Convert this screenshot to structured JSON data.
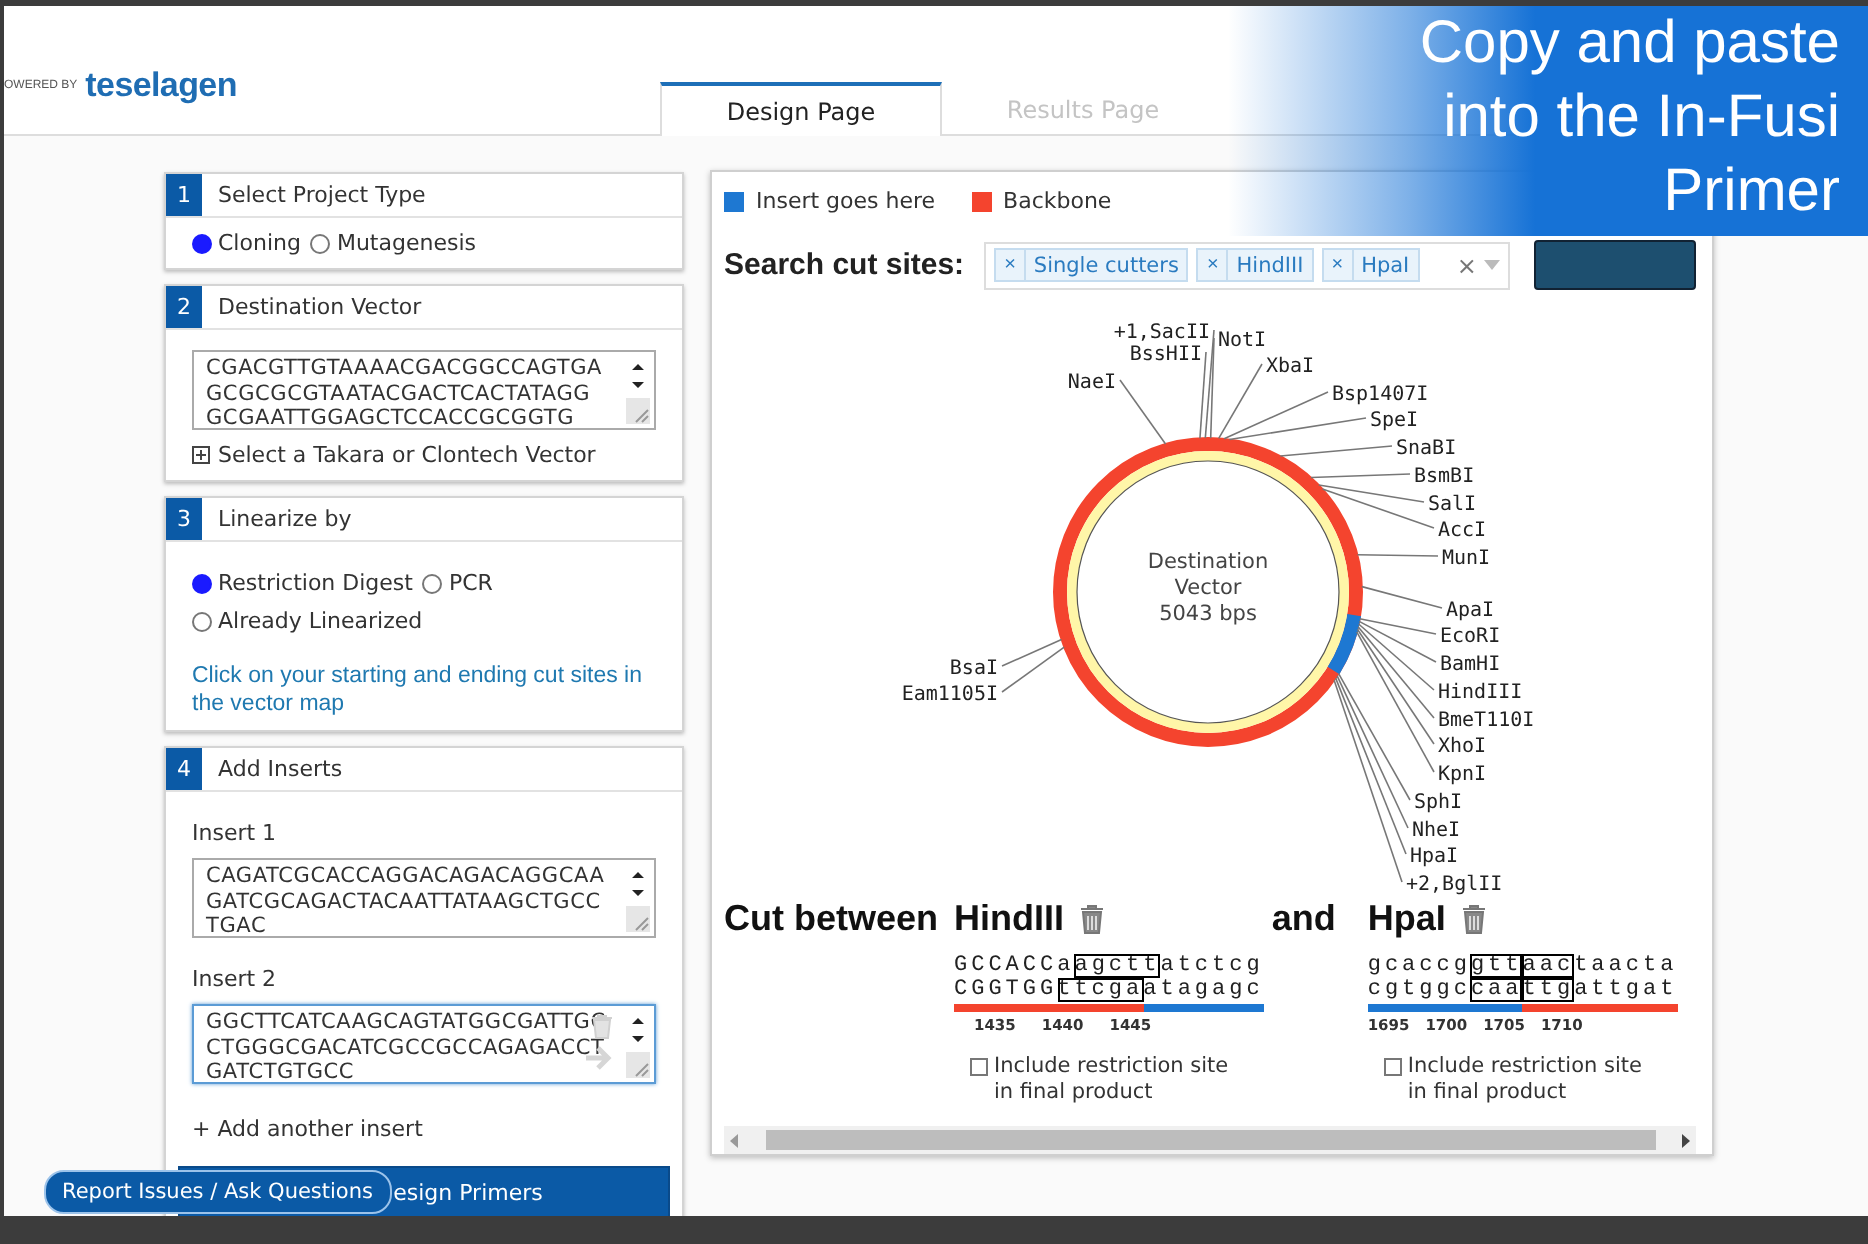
{
  "header": {
    "powered_by": "OWERED BY",
    "logo": "teselagen"
  },
  "tabs": [
    {
      "label": "Design Page",
      "selected": true
    },
    {
      "label": "Results Page",
      "selected": false
    }
  ],
  "steps": [
    {
      "number": "1",
      "title": "Select Project Type",
      "radio_rows": [
        [
          {
            "label": "Cloning",
            "selected": true
          },
          {
            "label": "Mutagenesis",
            "selected": false
          }
        ]
      ]
    },
    {
      "number": "2",
      "title": "Destination Vector",
      "sequence_lines": [
        "CGACGTTGTAAAACGACGGCCAGTGA",
        "GCGCGCGTAATACGACTCACTATAGG",
        "GCGAATTGGAGCTCCACCGCGGTG"
      ],
      "vector_link": "Select a Takara or Clontech Vector"
    },
    {
      "number": "3",
      "title": "Linearize by",
      "radio_rows": [
        [
          {
            "label": "Restriction Digest",
            "selected": true
          },
          {
            "label": "PCR",
            "selected": false
          }
        ],
        [
          {
            "label": "Already Linearized",
            "selected": false
          }
        ]
      ],
      "note": "Click on your starting and ending cut sites in the vector map"
    },
    {
      "number": "4",
      "title": "Add Inserts",
      "inserts": [
        {
          "label": "Insert 1",
          "focused": false,
          "lines": [
            "CAGATCGCACCAGGACAGACAGGCAA",
            "GATCGCAGACTACAATTATAAGCTGCC",
            "TGAC"
          ]
        },
        {
          "label": "Insert 2",
          "focused": true,
          "lines": [
            "GGCTTCATCAAGCAGTATGGCGATTGC",
            "CTGGGCGACATCGCCGCCAGAGACCT",
            "GATCTGTGCC"
          ]
        }
      ],
      "add_insert": "+ Add another insert",
      "primary_button": "esign Primers"
    }
  ],
  "map": {
    "legend": [
      {
        "label": "Insert goes here",
        "kind": "insert"
      },
      {
        "label": "Backbone",
        "kind": "backbone"
      }
    ],
    "search_label": "Search cut sites:",
    "tags": [
      {
        "label": "Single cutters",
        "remove": "×"
      },
      {
        "label": "HindIII",
        "remove": "×"
      },
      {
        "label": "HpaI",
        "remove": "×"
      }
    ],
    "clear": "×",
    "title_lines": [
      "Destination",
      "Vector",
      "5043 bps"
    ],
    "sites": [
      "+1,SacII",
      "NotI",
      "BssHII",
      "XbaI",
      "NaeI",
      "Bsp1407I",
      "SpeI",
      "SnaBI",
      "BsmBI",
      "SalI",
      "AccI",
      "MunI",
      "ApaI",
      "EcoRI",
      "BamHI",
      "HindIII",
      "BmeT110I",
      "XhoI",
      "KpnI",
      "SphI",
      "NheI",
      "HpaI",
      "+2,BglII",
      "BsaI",
      "Eam1105I"
    ]
  },
  "cut": {
    "label": "Cut between",
    "joiner": "and",
    "sites": [
      {
        "name": "HindIII",
        "top": [
          {
            "text": "GCCACCa",
            "boxed": false
          },
          {
            "text": "agctt",
            "boxed": true
          },
          {
            "text": "atctcg",
            "boxed": false
          }
        ],
        "bottom": [
          {
            "text": "CGGTGG",
            "boxed": false,
            "kind": "backbone"
          },
          {
            "text": "ttcga",
            "boxed": true,
            "kind": "backbone"
          },
          {
            "text": "atagagc",
            "boxed": false,
            "kind": "insert"
          }
        ],
        "ticks": [
          "1435",
          "1440",
          "1445"
        ],
        "checkbox": {
          "label": "Include restriction site in final product",
          "checked": false
        }
      },
      {
        "name": "HpaI",
        "top": [
          {
            "text": "gcaccg",
            "boxed": false
          },
          {
            "text": "gtt",
            "boxed": true
          },
          {
            "text": "aac",
            "boxed": true
          },
          {
            "text": "taacta",
            "boxed": false
          }
        ],
        "bottom": [
          {
            "text": "cgtggc",
            "boxed": false,
            "kind": "insert"
          },
          {
            "text": "caa",
            "boxed": true,
            "kind": "insert"
          },
          {
            "text": "ttg",
            "boxed": true,
            "kind": "backbone"
          },
          {
            "text": "attgat",
            "boxed": false,
            "kind": "backbone"
          }
        ],
        "ticks": [
          "1695",
          "1700",
          "1705",
          "1710"
        ],
        "checkbox": {
          "label": "Include restriction site in final product",
          "checked": false
        }
      }
    ]
  },
  "overlay": {
    "lines": [
      "Copy and paste",
      "into the In-Fusi",
      "Primer"
    ]
  },
  "report_button": "Report Issues / Ask Questions"
}
